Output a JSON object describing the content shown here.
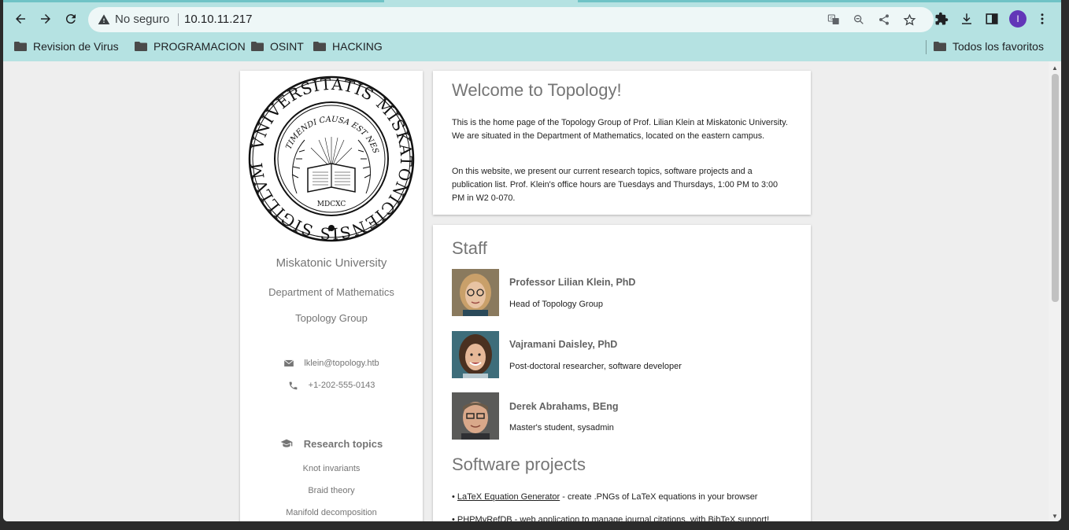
{
  "browser": {
    "omnibox": {
      "security_label": "No seguro",
      "url": "10.10.11.217"
    },
    "profile_initial": "I",
    "bookmarks": [
      {
        "label": "Revision de Virus"
      },
      {
        "label": "PROGRAMACION"
      },
      {
        "label": "OSINT"
      },
      {
        "label": "HACKING"
      }
    ],
    "all_bookmarks_label": "Todos los favoritos"
  },
  "sidebar": {
    "seal": {
      "outer_text": "VNIVERSITATIS MISKATONICIENSIS SIGILLVM",
      "inner_text": "TIMENDI CAUSA EST NESCIRE",
      "year": "MDCXC"
    },
    "university": "Miskatonic University",
    "department": "Department of Mathematics",
    "group": "Topology Group",
    "email": "lklein@topology.htb",
    "phone": "+1-202-555-0143",
    "research_heading": "Research topics",
    "research_topics": [
      "Knot invariants",
      "Braid theory",
      "Manifold decomposition"
    ]
  },
  "welcome": {
    "title": "Welcome to Topology!",
    "paragraph1": "This is the home page of the Topology Group of Prof. Lilian Klein at Miskatonic University. We are situated in the Department of Mathematics, located on the eastern campus.",
    "paragraph2": "On this website, we present our current research topics, software projects and a publication list. Prof. Klein's office hours are Tuesdays and Thursdays, 1:00 PM to 3:00 PM in W2 0-070."
  },
  "staff": {
    "title": "Staff",
    "members": [
      {
        "name": "Professor Lilian Klein, PhD",
        "role": "Head of Topology Group"
      },
      {
        "name": "Vajramani Daisley, PhD",
        "role": "Post-doctoral researcher, software developer"
      },
      {
        "name": "Derek Abrahams, BEng",
        "role": "Master's student, sysadmin"
      }
    ]
  },
  "software": {
    "title": "Software projects",
    "projects": [
      {
        "link": "LaTeX Equation Generator",
        "desc": " - create .PNGs of LaTeX equations in your browser"
      },
      {
        "link": "PHPMyRefDB",
        "desc": " - web application to manage journal citations, with BibTeX support!"
      }
    ]
  }
}
